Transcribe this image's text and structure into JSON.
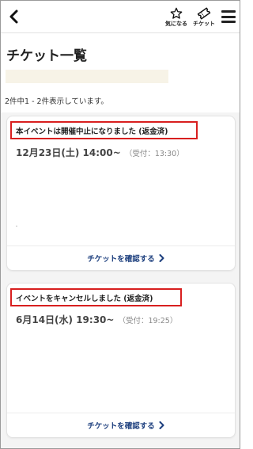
{
  "header": {
    "favorites_label": "気になる",
    "tickets_label": "チケット",
    "back_icon": "chevron-left-icon",
    "favorites_icon": "star-outline-icon",
    "tickets_icon": "ticket-icon",
    "menu_icon": "hamburger-menu-icon"
  },
  "page": {
    "title": "チケット一覧",
    "result_count": "2件中1 - 2件表示しています。"
  },
  "tickets": [
    {
      "status": "本イベントは開催中止になりました (返金済)",
      "datetime": "12月23日(土) 14:00~",
      "reception": "（受付：13:30）",
      "action_label": "チケットを確認する"
    },
    {
      "status": "イベントをキャンセルしました (返金済)",
      "datetime": "6月14日(水) 19:30~",
      "reception": "（受付：19:25）",
      "action_label": "チケットを確認する"
    }
  ],
  "colors": {
    "highlight_border": "#d81f1f",
    "link": "#1d3f7e",
    "background": "#f4f4f4"
  }
}
